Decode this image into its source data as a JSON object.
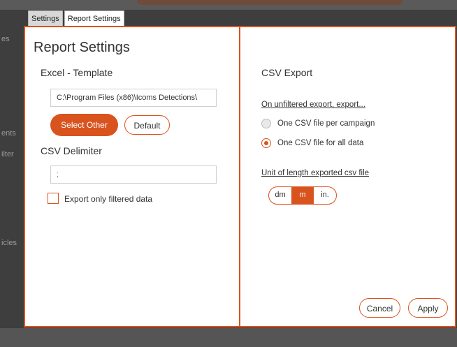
{
  "background": {
    "sidebar_fragments": [
      "es",
      "ents",
      "ilter",
      "icles"
    ]
  },
  "tabs": [
    {
      "label": "Settings",
      "active": false
    },
    {
      "label": "Report Settings",
      "active": true
    }
  ],
  "left": {
    "title": "Report Settings",
    "excel_section": "Excel - Template",
    "template_path": "C:\\Program Files (x86)\\Icoms Detections\\",
    "select_other_label": "Select Other",
    "default_label": "Default",
    "csv_delimiter_section": "CSV Delimiter",
    "delimiter_value": ";",
    "export_filtered_label": "Export only filtered data",
    "export_filtered_checked": false
  },
  "right": {
    "csv_export_title": "CSV Export",
    "unfiltered_label": "On unfiltered export, export...",
    "options": [
      {
        "label": "One CSV file per campaign",
        "checked": false
      },
      {
        "label": "One CSV file for all data",
        "checked": true
      }
    ],
    "unit_label": "Unit of length exported csv file",
    "units": [
      "dm",
      "m",
      "in."
    ],
    "selected_unit": "m",
    "cancel_label": "Cancel",
    "apply_label": "Apply"
  },
  "colors": {
    "accent": "#d9531e"
  }
}
